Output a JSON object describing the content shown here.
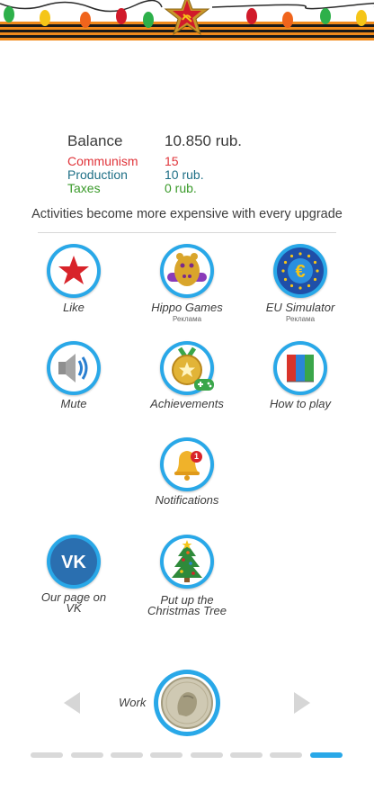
{
  "stats": {
    "balance_label": "Balance",
    "balance_value": "10.850 rub.",
    "communism_label": "Communism",
    "communism_value": "15",
    "production_label": "Production",
    "production_value": "10 rub.",
    "taxes_label": "Taxes",
    "taxes_value": "0 rub.",
    "colors": {
      "communism": "#e0343a",
      "production": "#1e6f86",
      "taxes": "#3a9a2a"
    }
  },
  "info_text": "Activities become more expensive with every upgrade",
  "menu": {
    "like": "Like",
    "hippo_games": "Hippo Games",
    "hippo_ad": "Реклама",
    "eu_simulator": "EU Simulator",
    "eu_ad": "Реклама",
    "mute": "Mute",
    "achievements": "Achievements",
    "how_to_play": "How to play",
    "notifications": "Notifications",
    "notification_badge": "1",
    "vk_page_line1": "Our page on",
    "vk_page_line2": "VK",
    "vk_logo_text": "VK",
    "tree_line1": "Put up the",
    "tree_line2": "Christmas Tree"
  },
  "work": {
    "label": "Work"
  },
  "pager": {
    "pages": 8,
    "active_page": 8
  },
  "colors": {
    "accent": "#29a8e8",
    "ribbon_orange": "#f08a1c",
    "ribbon_black": "#1a1a1a"
  },
  "icons": [
    "soviet-star-emblem-icon",
    "light-bulb-garland-icon",
    "red-star-icon",
    "hippo-icon",
    "eu-globe-icon",
    "speaker-icon",
    "medal-gamepad-icon",
    "book-icon",
    "bell-icon",
    "vk-icon",
    "christmas-tree-icon",
    "lenin-coin-icon",
    "arrow-left-icon",
    "arrow-right-icon"
  ]
}
